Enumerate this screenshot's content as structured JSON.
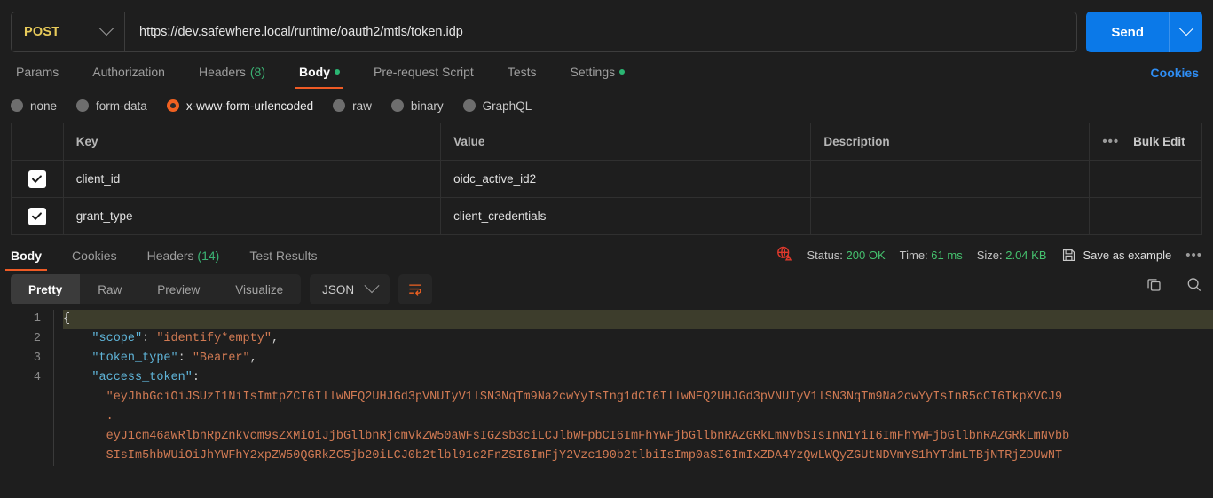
{
  "request": {
    "method": "POST",
    "url": "https://dev.safewhere.local/runtime/oauth2/mtls/token.idp",
    "send_label": "Send",
    "cookies_link": "Cookies",
    "tabs": [
      {
        "label": "Params",
        "count": "",
        "dot": false,
        "active": false
      },
      {
        "label": "Authorization",
        "count": "",
        "dot": false,
        "active": false
      },
      {
        "label": "Headers",
        "count": "(8)",
        "dot": false,
        "active": false
      },
      {
        "label": "Body",
        "count": "",
        "dot": true,
        "active": true
      },
      {
        "label": "Pre-request Script",
        "count": "",
        "dot": false,
        "active": false
      },
      {
        "label": "Tests",
        "count": "",
        "dot": false,
        "active": false
      },
      {
        "label": "Settings",
        "count": "",
        "dot": true,
        "active": false
      }
    ],
    "body_types": [
      {
        "label": "none",
        "selected": false
      },
      {
        "label": "form-data",
        "selected": false
      },
      {
        "label": "x-www-form-urlencoded",
        "selected": true
      },
      {
        "label": "raw",
        "selected": false
      },
      {
        "label": "binary",
        "selected": false
      },
      {
        "label": "GraphQL",
        "selected": false
      }
    ],
    "table": {
      "headers": {
        "key": "Key",
        "value": "Value",
        "description": "Description"
      },
      "bulk_edit": "Bulk Edit",
      "more": "•••",
      "rows": [
        {
          "checked": true,
          "key": "client_id",
          "value": "oidc_active_id2",
          "description": ""
        },
        {
          "checked": true,
          "key": "grant_type",
          "value": "client_credentials",
          "description": ""
        }
      ]
    }
  },
  "response": {
    "tabs": [
      {
        "label": "Body",
        "count": "",
        "active": true
      },
      {
        "label": "Cookies",
        "count": "",
        "active": false
      },
      {
        "label": "Headers",
        "count": "(14)",
        "active": false
      },
      {
        "label": "Test Results",
        "count": "",
        "active": false
      }
    ],
    "status_label": "Status:",
    "status_value": "200 OK",
    "time_label": "Time:",
    "time_value": "61 ms",
    "size_label": "Size:",
    "size_value": "2.04 KB",
    "save_as_example": "Save as example",
    "more_menu": "•••",
    "view_modes": [
      {
        "label": "Pretty",
        "active": true
      },
      {
        "label": "Raw",
        "active": false
      },
      {
        "label": "Preview",
        "active": false
      },
      {
        "label": "Visualize",
        "active": false
      }
    ],
    "format": "JSON",
    "code": {
      "line_numbers": [
        "1",
        "2",
        "3",
        "4"
      ],
      "lines": [
        {
          "num": "1",
          "highlight": true,
          "indent": 0,
          "segments": [
            {
              "t": "{",
              "c": "pun"
            }
          ]
        },
        {
          "num": "2",
          "highlight": false,
          "indent": 4,
          "segments": [
            {
              "t": "\"scope\"",
              "c": "key"
            },
            {
              "t": ": ",
              "c": "pun"
            },
            {
              "t": "\"identify*empty\"",
              "c": "str"
            },
            {
              "t": ",",
              "c": "pun"
            }
          ]
        },
        {
          "num": "3",
          "highlight": false,
          "indent": 4,
          "segments": [
            {
              "t": "\"token_type\"",
              "c": "key"
            },
            {
              "t": ": ",
              "c": "pun"
            },
            {
              "t": "\"Bearer\"",
              "c": "str"
            },
            {
              "t": ",",
              "c": "pun"
            }
          ]
        },
        {
          "num": "4",
          "highlight": false,
          "indent": 4,
          "segments": [
            {
              "t": "\"access_token\"",
              "c": "key"
            },
            {
              "t": ":",
              "c": "pun"
            }
          ]
        },
        {
          "num": "",
          "highlight": false,
          "indent": 6,
          "segments": [
            {
              "t": "\"eyJhbGciOiJSUzI1NiIsImtpZCI6IllwNEQ2UHJGd3pVNUIyV1lSN3NqTm9Na2cwYyIsIng1dCI6IllwNEQ2UHJGd3pVNUIyV1lSN3NqTm9Na2cwYyIsInR5cCI6IkpXVCJ9",
              "c": "str"
            }
          ]
        },
        {
          "num": "",
          "highlight": false,
          "indent": 6,
          "segments": [
            {
              "t": ".",
              "c": "str"
            }
          ]
        },
        {
          "num": "",
          "highlight": false,
          "indent": 6,
          "segments": [
            {
              "t": "eyJ1cm46aWRlbnRpZnkvcm9sZXMiOiJjbGllbnRjcmVkZW50aWFsIGZsb3ciLCJlbWFpbCI6ImFhYWFjbGllbnRAZGRkLmNvbSIsInN1YiI6ImFhYWFjbGllbnRAZGRkLmNvbb",
              "c": "str"
            }
          ]
        },
        {
          "num": "",
          "highlight": false,
          "indent": 6,
          "segments": [
            {
              "t": "SIsIm5hbWUiOiJhYWFhY2xpZW50QGRkZC5jb20iLCJ0b2tlbl91c2FnZSI6ImFjY2Vzc190b2tlbiIsImp0aSI6ImIxZDA4YzQwLWQyZGUtNDVmYS1hYTdmLTBjNTRjZDUwNT",
              "c": "str"
            }
          ]
        }
      ]
    }
  }
}
